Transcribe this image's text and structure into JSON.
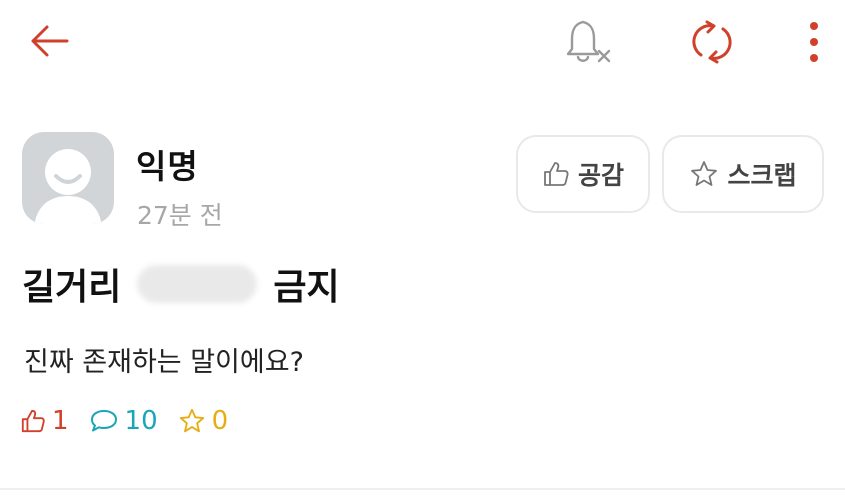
{
  "toolbar": {
    "back_icon": "arrow-left-icon",
    "notification_icon": "bell-off-icon",
    "refresh_icon": "refresh-icon",
    "menu_icon": "more-vertical-icon"
  },
  "author": {
    "name": "익명",
    "time": "27분 전"
  },
  "actions": {
    "empathy_label": "공감",
    "scrap_label": "스크랩"
  },
  "post": {
    "title_start": "길거리",
    "title_end": "금지",
    "body": "진짜 존재하는 말이에요?"
  },
  "stats": {
    "likes": "1",
    "comments": "10",
    "scraps": "0"
  },
  "colors": {
    "accent_red": "#d0412b",
    "comment_teal": "#1aa6b7",
    "star_yellow": "#e6ad15"
  }
}
